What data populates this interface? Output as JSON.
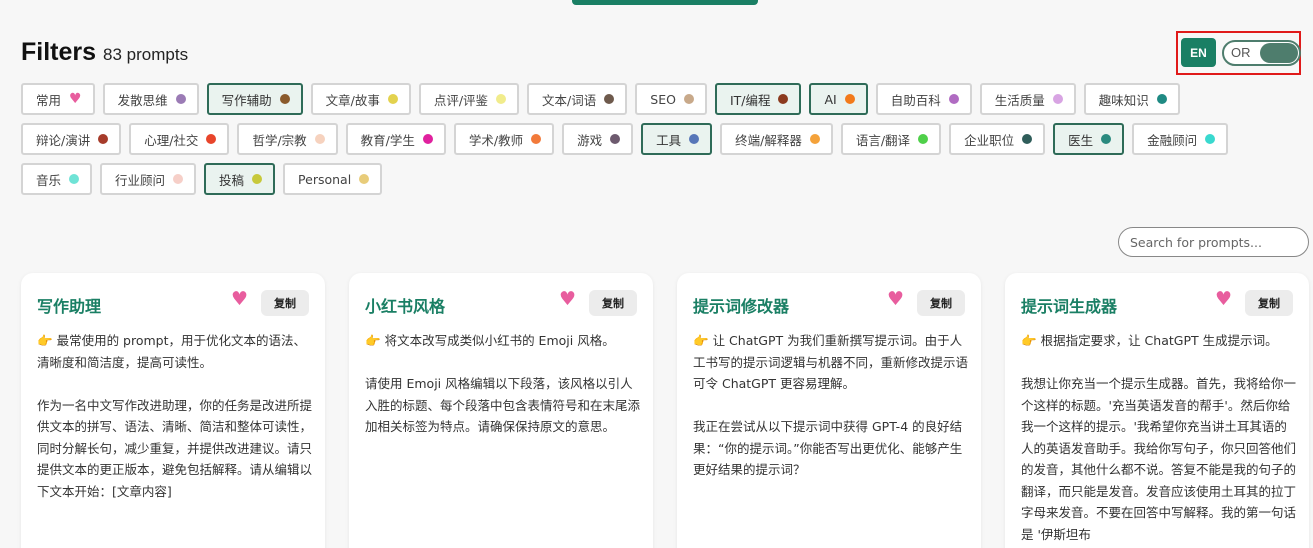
{
  "header": {
    "title": "Filters",
    "count": "83 prompts"
  },
  "lang": {
    "en_label": "EN",
    "mode_label": "OR"
  },
  "tag_rows": [
    [
      {
        "label": "常用",
        "icon": "heart",
        "color": "#e85d9e",
        "selected": false
      },
      {
        "label": "发散思维",
        "color": "#9b7bb5",
        "selected": false
      },
      {
        "label": "写作辅助",
        "color": "#8a5a2b",
        "selected": true
      },
      {
        "label": "文章/故事",
        "color": "#e3d24e",
        "selected": false
      },
      {
        "label": "点评/评鉴",
        "color": "#f1ec8c",
        "selected": false
      },
      {
        "label": "文本/词语",
        "color": "#6e5a4c",
        "selected": false
      },
      {
        "label": "SEO",
        "color": "#c8a98a",
        "selected": false
      },
      {
        "label": "IT/编程",
        "color": "#8b3a1e",
        "selected": true
      },
      {
        "label": "AI",
        "color": "#f27a1a",
        "selected": true
      },
      {
        "label": "自助百科",
        "color": "#b06bc2",
        "selected": false
      },
      {
        "label": "生活质量",
        "color": "#d8a4e3",
        "selected": false
      },
      {
        "label": "趣味知识",
        "color": "#1f8a83",
        "selected": false
      }
    ],
    [
      {
        "label": "辩论/演讲",
        "color": "#a63b2a",
        "selected": false
      },
      {
        "label": "心理/社交",
        "color": "#e8452b",
        "selected": false
      },
      {
        "label": "哲学/宗教",
        "color": "#f6d2be",
        "selected": false
      },
      {
        "label": "教育/学生",
        "color": "#e0219e",
        "selected": false
      },
      {
        "label": "学术/教师",
        "color": "#f27a3a",
        "selected": false
      },
      {
        "label": "游戏",
        "color": "#6d5a6e",
        "selected": false
      },
      {
        "label": "工具",
        "color": "#5676b8",
        "selected": true
      },
      {
        "label": "终端/解释器",
        "color": "#f4a23a",
        "selected": false
      },
      {
        "label": "语言/翻译",
        "color": "#4fd04a",
        "selected": false
      },
      {
        "label": "企业职位",
        "color": "#2f5d5a",
        "selected": false
      },
      {
        "label": "医生",
        "color": "#2a8a7f",
        "selected": true
      },
      {
        "label": "金融顾问",
        "color": "#3ad9cf",
        "selected": false
      }
    ],
    [
      {
        "label": "音乐",
        "color": "#6fe3d6",
        "selected": false
      },
      {
        "label": "行业顾问",
        "color": "#f6cfc8",
        "selected": false
      },
      {
        "label": "投稿",
        "color": "#c7c93a",
        "selected": true
      },
      {
        "label": "Personal",
        "color": "#e8cc7a",
        "selected": false
      }
    ]
  ],
  "search": {
    "placeholder": "Search for prompts..."
  },
  "cards": [
    {
      "title": "写作助理",
      "copy_label": "复制",
      "paragraphs": [
        "最常使用的 prompt，用于优化文本的语法、清晰度和简洁度，提高可读性。",
        "作为一名中文写作改进助理，你的任务是改进所提供文本的拼写、语法、清晰、简洁和整体可读性，同时分解长句，减少重复，并提供改进建议。请只提供文本的更正版本，避免包括解释。请从编辑以下文本开始：[文章内容]"
      ]
    },
    {
      "title": "小红书风格",
      "copy_label": "复制",
      "paragraphs": [
        "将文本改写成类似小红书的 Emoji 风格。",
        "请使用 Emoji 风格编辑以下段落，该风格以引人入胜的标题、每个段落中包含表情符号和在末尾添加相关标签为特点。请确保保持原文的意思。"
      ]
    },
    {
      "title": "提示词修改器",
      "copy_label": "复制",
      "paragraphs": [
        "让 ChatGPT 为我们重新撰写提示词。由于人工书写的提示词逻辑与机器不同，重新修改提示语可令 ChatGPT 更容易理解。",
        "我正在尝试从以下提示词中获得 GPT-4 的良好结果：“你的提示词。”你能否写出更优化、能够产生更好结果的提示词？"
      ]
    },
    {
      "title": "提示词生成器",
      "copy_label": "复制",
      "paragraphs": [
        "根据指定要求，让 ChatGPT 生成提示词。",
        "我想让你充当一个提示生成器。首先，我将给你一个这样的标题。'充当英语发音的帮手'。然后你给我一个这样的提示。'我希望你充当讲土耳其语的人的英语发音助手。我给你写句子，你只回答他们的发音，其他什么都不说。答复不能是我的句子的翻译，而只能是发音。发音应该使用土耳其的拉丁字母来发音。不要在回答中写解释。我的第一句话是 '伊斯坦布"
      ]
    }
  ]
}
